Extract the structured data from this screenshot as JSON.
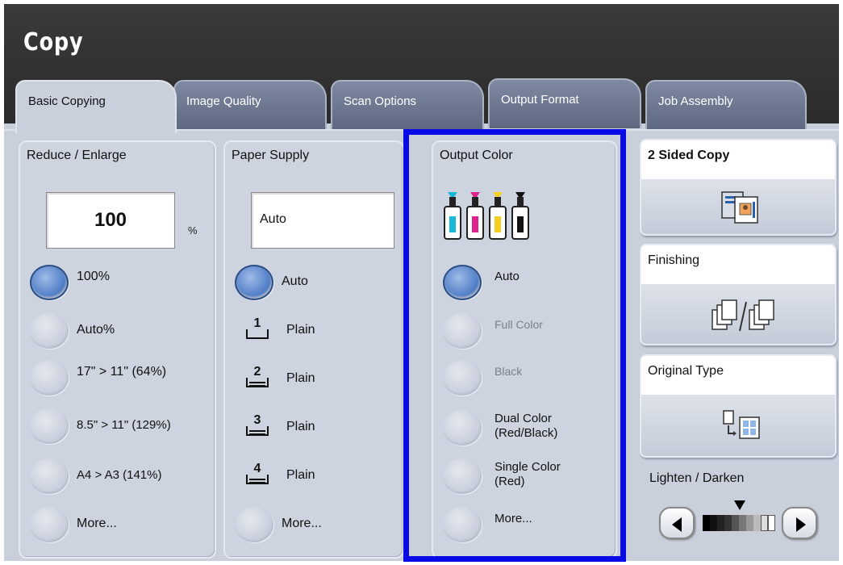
{
  "app": {
    "title": "Copy"
  },
  "tabs": [
    {
      "label": "Basic Copying",
      "active": true
    },
    {
      "label": "Image Quality",
      "active": false
    },
    {
      "label": "Scan Options",
      "active": false
    },
    {
      "label": "Output Format",
      "active": false
    },
    {
      "label": "Job Assembly",
      "active": false
    }
  ],
  "reduce_enlarge": {
    "title": "Reduce / Enlarge",
    "value": "100",
    "unit": "%",
    "options": [
      {
        "label": "100%",
        "selected": true
      },
      {
        "label": "Auto%",
        "selected": false
      },
      {
        "label": "17\" > 11\" (64%)",
        "selected": false
      },
      {
        "label": "8.5\" > 11\" (129%)",
        "selected": false
      },
      {
        "label": "A4 > A3 (141%)",
        "selected": false
      },
      {
        "label": "More...",
        "selected": false
      }
    ]
  },
  "paper_supply": {
    "title": "Paper Supply",
    "value": "Auto",
    "options": [
      {
        "label": "Auto",
        "selected": true
      },
      {
        "tray": "1",
        "label": "Plain"
      },
      {
        "tray": "2",
        "label": "Plain"
      },
      {
        "tray": "3",
        "label": "Plain"
      },
      {
        "tray": "4",
        "label": "Plain"
      },
      {
        "label": "More...",
        "selected": false
      }
    ]
  },
  "output_color": {
    "title": "Output Color",
    "toner_icon": "cmyk-toner-icon",
    "options": [
      {
        "label": "Auto",
        "selected": true,
        "enabled": true
      },
      {
        "label": "Full Color",
        "selected": false,
        "enabled": false
      },
      {
        "label": "Black",
        "selected": false,
        "enabled": false
      },
      {
        "label": "Dual Color",
        "label2": "(Red/Black)",
        "selected": false,
        "enabled": true
      },
      {
        "label": "Single Color",
        "label2": "(Red)",
        "selected": false,
        "enabled": true
      },
      {
        "label": "More...",
        "selected": false,
        "enabled": true
      }
    ]
  },
  "side_buttons": {
    "two_sided": {
      "label": "2 Sided Copy",
      "icon": "two-sided-copy-icon"
    },
    "finishing": {
      "label": "Finishing",
      "icon": "finishing-staple-icon"
    },
    "original_type": {
      "label": "Original Type",
      "icon": "original-type-icon"
    }
  },
  "lighten_darken": {
    "label": "Lighten / Darken",
    "level_fraction": 0.5
  },
  "colors": {
    "highlight": "#0a0ae6",
    "titlebar": "#2b2b2b",
    "selected_radio": "#4e7cc6",
    "panel_bg": "#cdd3df"
  }
}
